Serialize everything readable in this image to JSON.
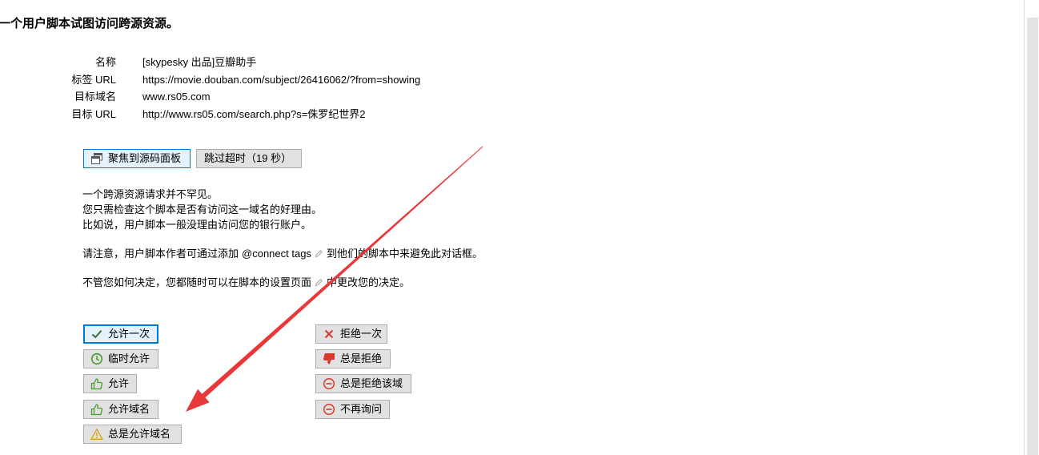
{
  "page": {
    "title": "一个用户脚本试图访问跨源资源。"
  },
  "info": [
    {
      "label": "名称",
      "value": "[skypesky 出品]豆瓣助手"
    },
    {
      "label": "标签 URL",
      "value": "https://movie.douban.com/subject/26416062/?from=showing"
    },
    {
      "label": "目标域名",
      "value": "www.rs05.com"
    },
    {
      "label": "目标 URL",
      "value": "http://www.rs05.com/search.php?s=侏罗纪世界2"
    }
  ],
  "actions": {
    "focus_source": {
      "label": "聚焦到源码面板",
      "icon": "window-icon"
    },
    "skip_timeout": {
      "label": "跳过超时（19 秒）"
    }
  },
  "explanation": {
    "lines": [
      "一个跨源资源请求并不罕见。",
      "您只需检查这个脚本是否有访问这一域名的好理由。",
      "比如说，用户脚本一般没理由访问您的银行账户。"
    ],
    "note_prefix": "请注意，用户脚本作者可通过添加",
    "note_link": "@connect tags",
    "note_link_icon": "pencil-icon",
    "note_suffix": "到他们的脚本中来避免此对话框。",
    "settings_prefix": "不管您如何决定，您都随时可以在脚本的设置页面",
    "settings_link_icon": "pencil-icon",
    "settings_suffix": "中更改您的决定。"
  },
  "allow_buttons": [
    {
      "label": "允许一次",
      "icon": "checkmark-icon"
    },
    {
      "label": "临时允许",
      "icon": "clock-icon"
    },
    {
      "label": "允许",
      "icon": "thumbs-up-icon"
    },
    {
      "label": "允许域名",
      "icon": "thumbs-up-icon"
    },
    {
      "label": "总是允许域名",
      "icon": "warning-icon"
    }
  ],
  "deny_buttons": [
    {
      "label": "拒绝一次",
      "icon": "x-icon"
    },
    {
      "label": "总是拒绝",
      "icon": "thumbs-down-icon"
    },
    {
      "label": "总是拒绝该域",
      "icon": "minus-circle-icon"
    },
    {
      "label": "不再询问",
      "icon": "minus-circle-icon"
    }
  ],
  "colors": {
    "accent": "#0078d7",
    "allow_icon": "#4e9a2e",
    "check_icon": "#3b6e35",
    "deny_icon": "#d93a2b",
    "warning_icon": "#d9a021",
    "annotation_arrow": "#e8383a"
  }
}
